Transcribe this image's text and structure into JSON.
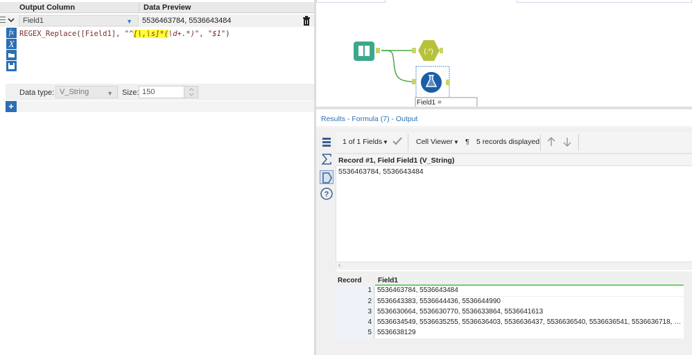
{
  "config": {
    "header_output_column": "Output Column",
    "header_data_preview": "Data Preview",
    "field_name": "Field1",
    "data_preview_value": "5536463784, 5536643484",
    "expression_parts": {
      "fn": "REGEX_Replace",
      "open": "(",
      "field": "[Field1]",
      "comma1": ", ",
      "q1": "\"^",
      "highlight": "[\\,\\s]*(",
      "rest": "\\d+.*)\"",
      "comma2": ", ",
      "replacement": "\"$1\"",
      "close": ")"
    },
    "data_type_label": "Data type:",
    "data_type_value": "V_String",
    "size_label": "Size:",
    "size_value": "150",
    "add_button": "+"
  },
  "canvas": {
    "formula_tool_label": "Field1 ="
  },
  "results": {
    "title": "Results - Formula (7) - Output",
    "fields_selector": "1 of 1 Fields",
    "cell_viewer": "Cell Viewer",
    "pilcrow": "¶",
    "records_displayed": "5 records displayed",
    "record_header": "Record #1, Field Field1 (V_String)",
    "cell_value": "5536463784, 5536643484",
    "grid": {
      "col_record": "Record",
      "col_field1": "Field1",
      "rows": [
        {
          "num": "1",
          "value": "5536463784, 5536643484"
        },
        {
          "num": "2",
          "value": "5536643383, 5536644436, 5536644990"
        },
        {
          "num": "3",
          "value": "5536630664, 5536630770, 5536633864, 5536641613"
        },
        {
          "num": "4",
          "value": "5536634549, 5536635255, 5536636403, 5536636437, 5536636540, 5536636541, 5536636718, 5536637769..."
        },
        {
          "num": "5",
          "value": "5536638129"
        }
      ]
    }
  },
  "colors": {
    "accent_blue": "#2b6fb5",
    "highlight_yellow": "#ffff33",
    "input_tool_teal": "#3aa88a",
    "regex_tool_olive": "#b7c23a",
    "formula_tool_blue": "#1b5ea8",
    "connector_green": "#4aa84a"
  }
}
